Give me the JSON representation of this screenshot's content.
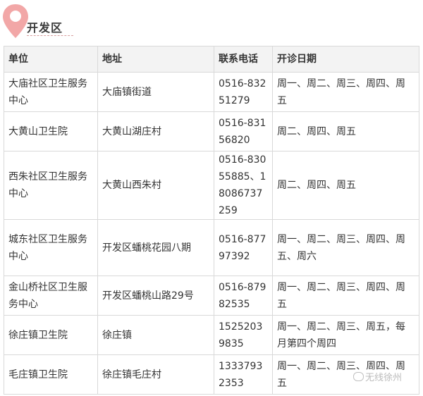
{
  "section_title": "开发区",
  "table": {
    "headers": [
      "单位",
      "地址",
      "联系电话",
      "开诊日期"
    ],
    "rows": [
      [
        "大庙社区卫生服务中心",
        "大庙镇街道",
        "0516-83251279",
        "周一、周二、周三、周四、周五"
      ],
      [
        "大黄山卫生院",
        "大黄山湖庄村",
        "0516-83156820",
        "周二、周四、周五"
      ],
      [
        "西朱社区卫生服务中心",
        "大黄山西朱村",
        "0516-83055885、18086737259",
        "周二、周四、周五"
      ],
      [
        "城东社区卫生服务中心",
        "开发区蟠桃花园八期",
        "0516-87797392",
        "周一、周二、周三、周四、周五、周六"
      ],
      [
        "金山桥社区卫生服务中心",
        "开发区蟠桃山路29号",
        "0516-87982535",
        "周一、周二、周三、周四、周五"
      ],
      [
        "徐庄镇卫生院",
        "徐庄镇",
        "15252039835",
        "周一、周二、周三、周五，每月第四个周四"
      ],
      [
        "毛庄镇卫生院",
        "徐庄镇毛庄村",
        "13337932353",
        "周一、周二、周三、周四、周五"
      ]
    ]
  },
  "watermark": "无线徐州",
  "colors": {
    "pin": "#f2a7a7",
    "pin_dark": "#e78f8f",
    "header_bg": "#f3f3f3",
    "border": "#d9d9d9"
  }
}
